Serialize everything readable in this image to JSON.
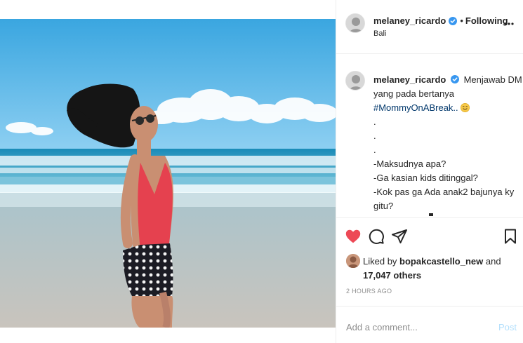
{
  "post": {
    "username": "melaney_ricardo",
    "dot": "•",
    "follow_status": "Following",
    "location": "Bali"
  },
  "caption": {
    "username": "melaney_ricardo",
    "first_line": "Menjawab DM",
    "second_line": "yang pada bertanya",
    "hashtag": "#MommyOnABreak..",
    "dots": [
      ".",
      ".",
      "."
    ],
    "lines": [
      "-Maksudnya apa?",
      "-Ga kasian kids ditinggal?",
      "-Kok pas ga Ada anak2 bajunya ky",
      "gitu?"
    ]
  },
  "likes": {
    "prefix": "Liked by",
    "liker": "bopakcastello_new",
    "and": "and",
    "count": "17,047 others"
  },
  "timestamp": "2 HOURS AGO",
  "comment": {
    "placeholder": "Add a comment...",
    "post_label": "Post"
  },
  "icons": {
    "like": "heart-icon-filled",
    "comment": "comment-bubble-icon",
    "share": "paper-plane-icon",
    "save": "bookmark-icon",
    "more": "more-options-icon",
    "verified": "verified-badge-icon"
  },
  "colors": {
    "heart": "#ed4956",
    "verified": "#3897f0",
    "hashtag": "#00376b",
    "post_disabled": "#b2dffc",
    "muted": "#8e8e8e"
  }
}
